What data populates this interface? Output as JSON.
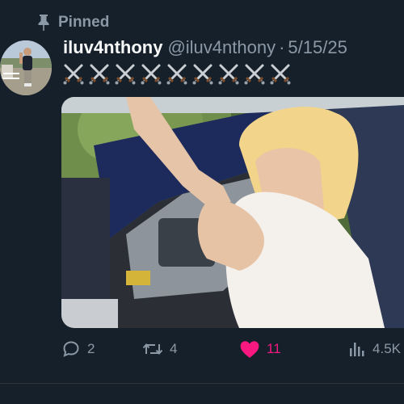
{
  "pinned": {
    "label": "Pinned",
    "icon": "pin-icon"
  },
  "author": {
    "display_name": "iluv4nthony",
    "handle": "@iluv4nthony",
    "separator": "·",
    "date": "5/15/25",
    "avatar": "avatar-photo"
  },
  "tweet": {
    "text": "⚔️⚔️⚔️⚔️⚔️⚔️⚔️⚔️⚔️",
    "emoji_icon": "crossed-swords-icon",
    "emoji_count": 9
  },
  "media": {
    "type": "photo",
    "icon": "photo-car-interior"
  },
  "actions": {
    "replies": "2",
    "retweets": "4",
    "likes": "11",
    "views": "4.5K",
    "like_color": "#f91880"
  }
}
